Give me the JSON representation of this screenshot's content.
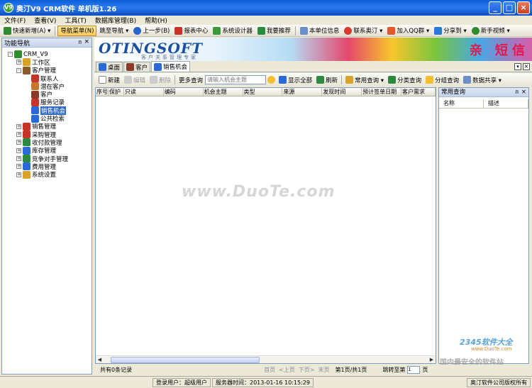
{
  "window": {
    "title": "奥汀V9 CRM软件 单机版1.26",
    "app_icon": "V9"
  },
  "menu": [
    "文件(F)",
    "查看(V)",
    "工具(T)",
    "数据库管理(B)",
    "帮助(H)"
  ],
  "toolbar": {
    "items": [
      {
        "label": "快速新增(A) ▾",
        "icon": "plus-icon",
        "color": "#2e8b2e"
      },
      {
        "label": "导航菜单(N)",
        "icon": "",
        "color": "",
        "active": true
      },
      {
        "label": "跳至导航 ▾",
        "icon": "",
        "color": ""
      },
      {
        "label": "上一步(B)",
        "icon": "back-icon",
        "color": "#2a64c8"
      },
      {
        "label": "报表中心",
        "icon": "report-icon",
        "color": "#c8332a"
      },
      {
        "label": "系统设计器",
        "icon": "designer-icon",
        "color": "#3a9a3a"
      },
      {
        "label": "我要推荐",
        "icon": "recommend-icon",
        "color": "#2a8a40"
      },
      {
        "label": "本单位信息",
        "icon": "company-info-icon",
        "color": "#6b8fc8"
      },
      {
        "label": "联系奥汀 ▾",
        "icon": "qq-icon",
        "color": "#d83a2a"
      },
      {
        "label": "加入QQ群 ▾",
        "icon": "qq-group-icon",
        "color": "#e05a2a"
      },
      {
        "label": "分享到 ▾",
        "icon": "share-icon",
        "color": "#2a7ad8"
      },
      {
        "label": "新手视频 ▾",
        "icon": "video-icon",
        "color": "#2e8b2e"
      }
    ]
  },
  "nav": {
    "header": "功能导航",
    "pin": "ᴨ",
    "close": "×",
    "tree": [
      {
        "label": "CRM_V9",
        "level": 0,
        "toggle": "-",
        "icon": "crm-root-icon",
        "color": "#2e8b2e"
      },
      {
        "label": "工作区",
        "level": 1,
        "toggle": "+",
        "icon": "workspace-icon",
        "color": "#d8a32a"
      },
      {
        "label": "客户管理",
        "level": 1,
        "toggle": "-",
        "icon": "customer-mgmt-icon",
        "color": "#8a5a2a"
      },
      {
        "label": "联系人",
        "level": 2,
        "toggle": "",
        "icon": "contact-icon",
        "color": "#c8332a"
      },
      {
        "label": "潜在客户",
        "level": 2,
        "toggle": "",
        "icon": "lead-icon",
        "color": "#c8782a"
      },
      {
        "label": "客户",
        "level": 2,
        "toggle": "",
        "icon": "customer-icon",
        "color": "#8a3a2a"
      },
      {
        "label": "服务记录",
        "level": 2,
        "toggle": "",
        "icon": "service-record-icon",
        "color": "#c8332a"
      },
      {
        "label": "销售机会",
        "level": 2,
        "toggle": "",
        "icon": "sales-opportunity-icon",
        "color": "#2a6ad8",
        "selected": true
      },
      {
        "label": "公共检索",
        "level": 2,
        "toggle": "",
        "icon": "search-icon",
        "color": "#2a6ad8"
      },
      {
        "label": "销售管理",
        "level": 1,
        "toggle": "+",
        "icon": "sales-mgmt-icon",
        "color": "#c8332a"
      },
      {
        "label": "采购管理",
        "level": 1,
        "toggle": "+",
        "icon": "purchase-icon",
        "color": "#c8332a"
      },
      {
        "label": "收付款管理",
        "level": 1,
        "toggle": "+",
        "icon": "payment-icon",
        "color": "#2a8a40"
      },
      {
        "label": "库存管理",
        "level": 1,
        "toggle": "+",
        "icon": "inventory-icon",
        "color": "#2a6ad8"
      },
      {
        "label": "竞争对手管理",
        "level": 1,
        "toggle": "+",
        "icon": "competitor-icon",
        "color": "#2a8a40"
      },
      {
        "label": "费用管理",
        "level": 1,
        "toggle": "+",
        "icon": "expense-icon",
        "color": "#2a6ad8"
      },
      {
        "label": "系统设置",
        "level": 1,
        "toggle": "+",
        "icon": "settings-icon",
        "color": "#d8a32a"
      }
    ]
  },
  "banner": {
    "logo": "OTINGSOFT",
    "tagline": "客户关系管理专家",
    "promo": "亲 短信"
  },
  "tabs": [
    {
      "label": "桌面",
      "icon": "desktop-icon",
      "color": "#2a6ad8"
    },
    {
      "label": "客户",
      "icon": "customer-icon",
      "color": "#8a3a2a"
    },
    {
      "label": "销售机会",
      "icon": "sales-opportunity-icon",
      "color": "#2a6ad8",
      "active": true
    }
  ],
  "subtoolbar": {
    "new": "新建",
    "edit": "编辑",
    "delete": "删除",
    "more_query": "更多查询",
    "search_placeholder": "请输入机会主题",
    "show_all": "显示全部",
    "refresh": "刷新",
    "common_query": "常用查询 ▾",
    "category_query": "分类查询",
    "group_query": "分组查询",
    "data_share": "数据共享 ▾"
  },
  "grid": {
    "columns": [
      "序号",
      "保护",
      "只读",
      "编码",
      "机会主题",
      "类型",
      "来源",
      "发现时间",
      "预计签单日期",
      "客户需求"
    ]
  },
  "right_panel": {
    "title": "常用查询",
    "pin": "ᴨ",
    "close": "×",
    "columns": [
      "名称",
      "描述"
    ]
  },
  "pager": {
    "records": "共有0条记录",
    "first": "首页",
    "prev": "<上页",
    "next": "下页>",
    "last": "末页",
    "page_info": "第1页/共1页",
    "jump_label": "跳转至第",
    "jump_value": "1",
    "page_unit": "页"
  },
  "status": {
    "user": "登录用户：超级用户",
    "server_time": "服务器时间：2013-01-16 10:15:29",
    "copyright": "奥汀软件公司版权所有"
  },
  "watermarks": {
    "center": "www.DuoTe.com",
    "corner_brand": "2345软件大全",
    "corner_url": "www.DuoTe.com",
    "corner_slogan": "国内最安全的软件站"
  }
}
